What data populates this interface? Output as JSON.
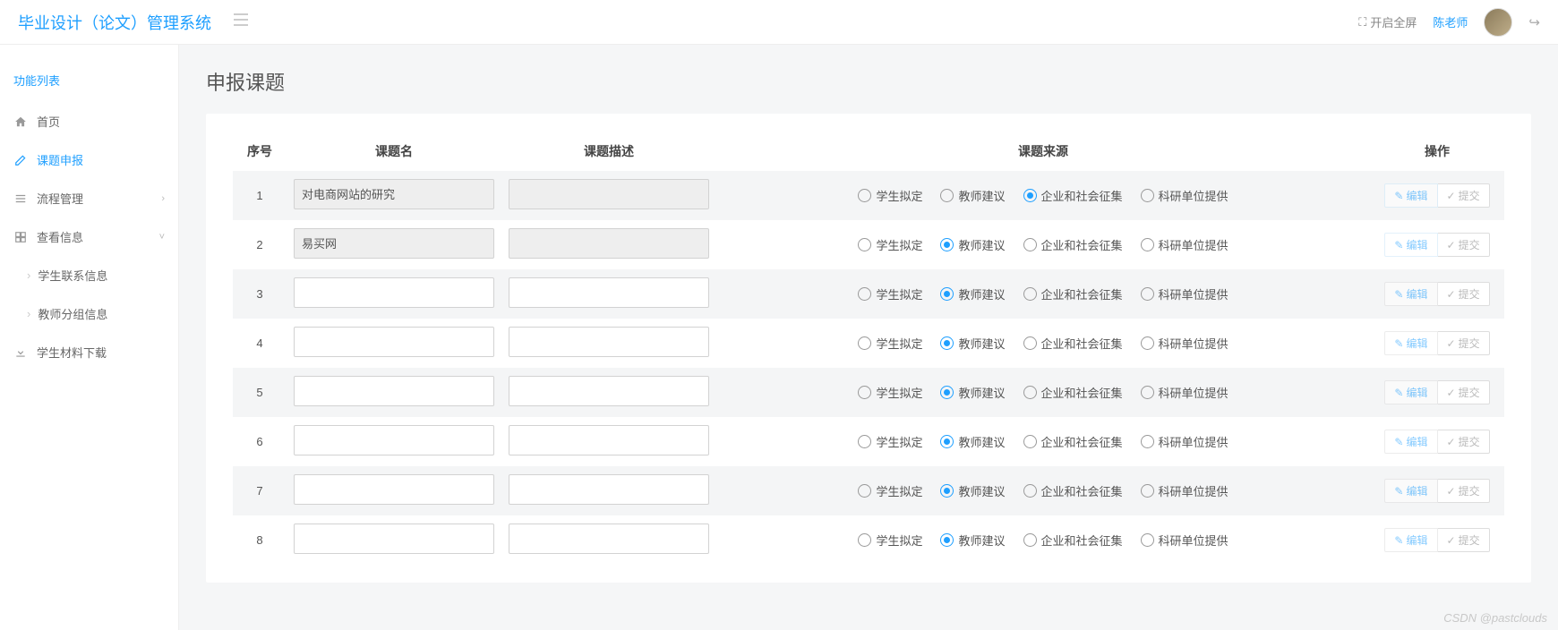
{
  "header": {
    "brand": "毕业设计（论文）管理系统",
    "fullscreen": "开启全屏",
    "username": "陈老师"
  },
  "sidebar": {
    "title": "功能列表",
    "items": [
      {
        "label": "首页",
        "icon": "home"
      },
      {
        "label": "课题申报",
        "icon": "edit",
        "active": true
      },
      {
        "label": "流程管理",
        "icon": "list",
        "arrow": "›"
      },
      {
        "label": "查看信息",
        "icon": "grid",
        "arrow": "˅"
      }
    ],
    "sub_items": [
      {
        "label": "学生联系信息"
      },
      {
        "label": "教师分组信息"
      }
    ],
    "extra": {
      "label": "学生材料下载",
      "icon": "download"
    }
  },
  "page": {
    "title": "申报课题",
    "columns": {
      "seq": "序号",
      "name": "课题名",
      "desc": "课题描述",
      "source": "课题来源",
      "action": "操作"
    },
    "source_options": [
      "学生拟定",
      "教师建议",
      "企业和社会征集",
      "科研单位提供"
    ],
    "actions": {
      "edit": "编辑",
      "submit": "提交"
    },
    "rows": [
      {
        "seq": "1",
        "name": "对电商网站的研究",
        "desc": "",
        "src": 2,
        "filled": true,
        "edit_active": true
      },
      {
        "seq": "2",
        "name": "易买网",
        "desc": "",
        "src": 1,
        "filled": true,
        "edit_active": true
      },
      {
        "seq": "3",
        "name": "",
        "desc": "",
        "src": 1,
        "filled": false,
        "edit_active": false
      },
      {
        "seq": "4",
        "name": "",
        "desc": "",
        "src": 1,
        "filled": false,
        "edit_active": false
      },
      {
        "seq": "5",
        "name": "",
        "desc": "",
        "src": 1,
        "filled": false,
        "edit_active": false
      },
      {
        "seq": "6",
        "name": "",
        "desc": "",
        "src": 1,
        "filled": false,
        "edit_active": false
      },
      {
        "seq": "7",
        "name": "",
        "desc": "",
        "src": 1,
        "filled": false,
        "edit_active": false
      },
      {
        "seq": "8",
        "name": "",
        "desc": "",
        "src": 1,
        "filled": false,
        "edit_active": false
      }
    ]
  },
  "watermark": "CSDN @pastclouds"
}
